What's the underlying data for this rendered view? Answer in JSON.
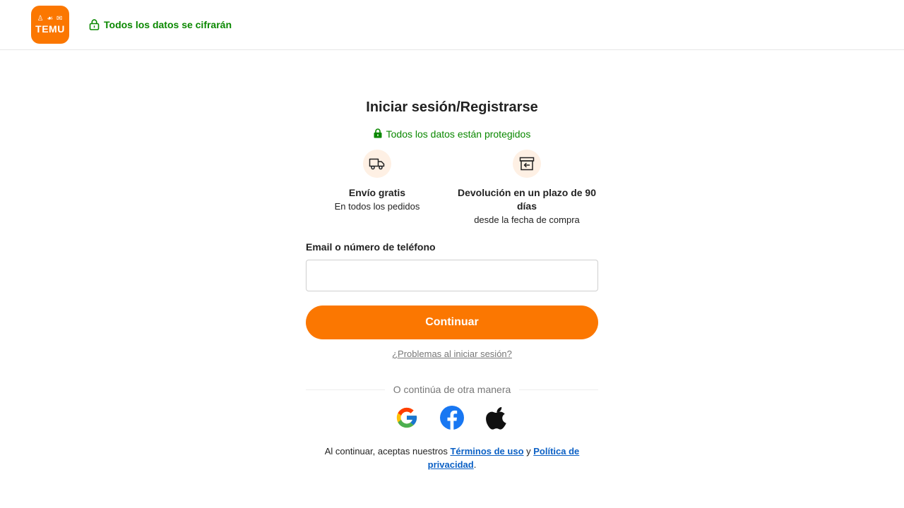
{
  "header": {
    "logo_text": "TEMU",
    "logo_icons": "♙ ☙ ✉",
    "secure_text": "Todos los datos se cifrarán"
  },
  "panel": {
    "title": "Iniciar sesión/Registrarse",
    "protected_text": "Todos los datos están protegidos",
    "benefits": [
      {
        "icon": "truck-icon",
        "title": "Envío gratis",
        "subtitle": "En todos los pedidos"
      },
      {
        "icon": "return-box-icon",
        "title": "Devolución en un plazo de 90 días",
        "subtitle": "desde la fecha de compra"
      }
    ],
    "field_label": "Email o número de teléfono",
    "field_value": "",
    "field_placeholder": "",
    "continue_label": "Continuar",
    "trouble_link": "¿Problemas al iniciar sesión?",
    "divider_text": "O continúa de otra manera",
    "social": [
      {
        "name": "google",
        "icon": "google-icon"
      },
      {
        "name": "facebook",
        "icon": "facebook-icon"
      },
      {
        "name": "apple",
        "icon": "apple-icon"
      }
    ],
    "terms": {
      "prefix": "Al continuar, aceptas nuestros",
      "terms_link": "Términos de uso",
      "and": "y",
      "privacy_link": "Política de privacidad",
      "suffix": "."
    }
  },
  "colors": {
    "brand_orange": "#fb7701",
    "secure_green": "#0a8800",
    "link_blue": "#0b60c5",
    "benefit_icon_bg": "#fef0e4"
  }
}
